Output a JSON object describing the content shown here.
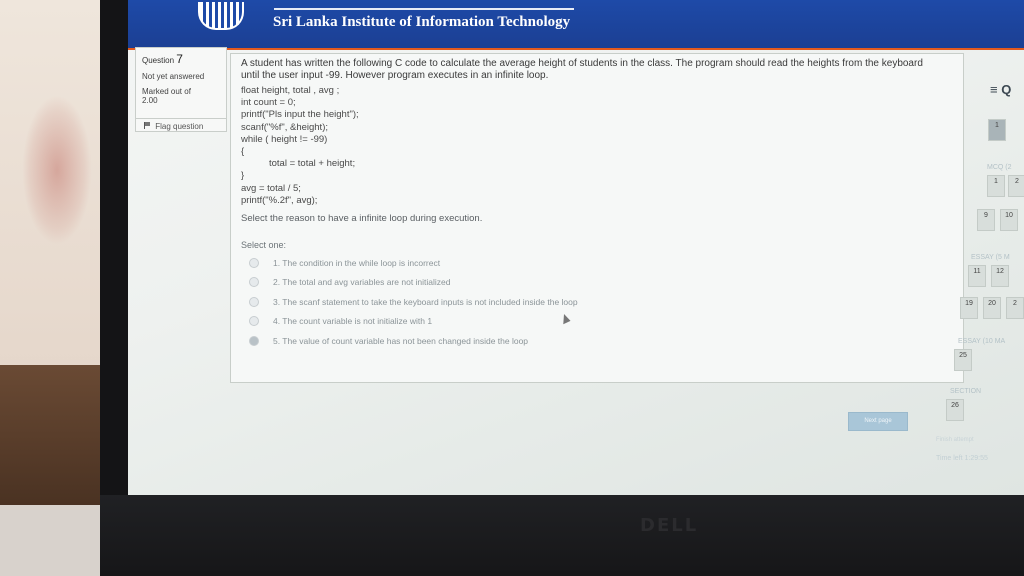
{
  "banner": {
    "title": "Sri Lanka Institute of Information Technology"
  },
  "question_info": {
    "label": "Question",
    "number": "7",
    "status": "Not yet answered",
    "marked_out_of": "Marked out of",
    "marks": "2.00",
    "flag_label": "Flag question"
  },
  "question": {
    "text": "A student has written the following C code to calculate the average height of students in the class. The program should read the heights from the keyboard until the user input -99. However program executes in an infinite loop.",
    "code": [
      "float height, total , avg ;",
      "int count = 0;",
      "printf(\"Pls input the height\");",
      "scanf(\"%f\", &height);",
      "while ( height != -99)",
      "{",
      "total = total + height;",
      "}",
      "avg = total / 5;",
      "printf(\"%.2f\", avg);"
    ],
    "prompt": "Select the reason to have a infinite loop during execution.",
    "select_one": "Select one:",
    "options": [
      "1. The condition in the while loop is incorrect",
      "2. The total and avg variables are not initialized",
      "3. The scanf statement to take the keyboard inputs is not included inside the loop",
      "4. The count variable is not initialize with 1",
      "5. The value of count variable has not been changed inside the loop"
    ],
    "selected_option": 5
  },
  "nav": {
    "title": "≡ Q",
    "section_mcq": "MCQ (2",
    "section_essay": "ESSAY (5 M",
    "section_essay2": "ESSAY (10 MA",
    "section_last": "SECTION",
    "buttons": [
      "1",
      "2",
      "9",
      "10",
      "11",
      "12",
      "19",
      "20",
      "2",
      "25",
      "26"
    ]
  },
  "footer": {
    "finish_label": "Next page",
    "timer_label": "Finish attempt",
    "timer": "Time left 1:29:55"
  },
  "device": {
    "brand": "DELL"
  }
}
